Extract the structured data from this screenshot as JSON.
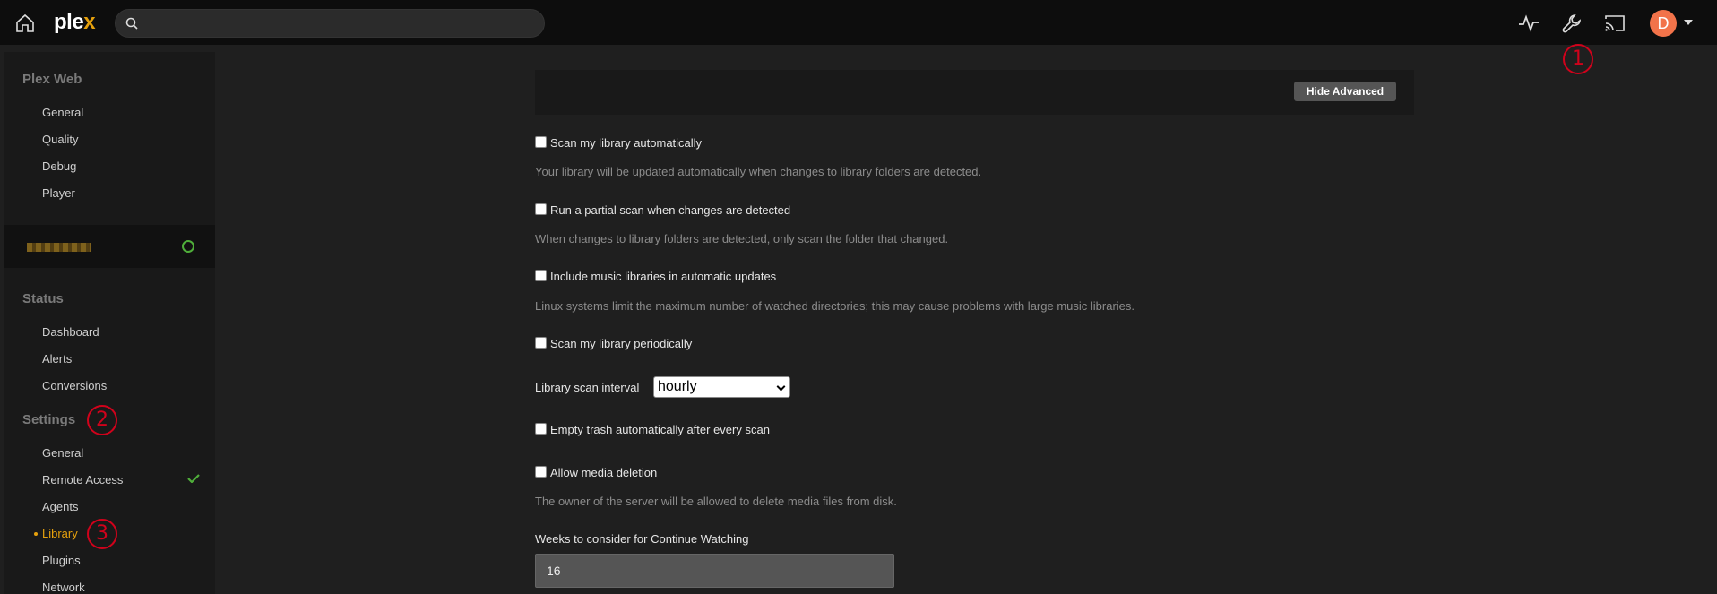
{
  "topbar": {
    "logo_main": "ple",
    "logo_x": "x",
    "search_placeholder": "",
    "avatar_initial": "D"
  },
  "annotations": [
    "1",
    "2",
    "3"
  ],
  "sidebar": {
    "plex_web_title": "Plex Web",
    "plex_web_items": [
      "General",
      "Quality",
      "Debug",
      "Player"
    ],
    "status_title": "Status",
    "status_items": [
      "Dashboard",
      "Alerts",
      "Conversions"
    ],
    "settings_title": "Settings",
    "settings_items": [
      "General",
      "Remote Access",
      "Agents",
      "Library",
      "Plugins",
      "Network"
    ],
    "active_item": "Library"
  },
  "main": {
    "hide_advanced_label": "Hide Advanced",
    "options": [
      {
        "label": "Scan my library automatically",
        "help": "Your library will be updated automatically when changes to library folders are detected.",
        "checked": false
      },
      {
        "label": "Run a partial scan when changes are detected",
        "help": "When changes to library folders are detected, only scan the folder that changed.",
        "checked": false
      },
      {
        "label": "Include music libraries in automatic updates",
        "help": "Linux systems limit the maximum number of watched directories; this may cause problems with large music libraries.",
        "checked": false
      },
      {
        "label": "Scan my library periodically",
        "help": "",
        "checked": false
      },
      {
        "label": "Empty trash automatically after every scan",
        "help": "",
        "checked": false
      },
      {
        "label": "Allow media deletion",
        "help": "The owner of the server will be allowed to delete media files from disk.",
        "checked": false
      }
    ],
    "scan_interval_label": "Library scan interval",
    "scan_interval_value": "hourly",
    "continue_watching_label": "Weeks to consider for Continue Watching",
    "continue_watching_value": "16"
  },
  "colors": {
    "accent": "#e5a00d",
    "annotation": "#d0021b",
    "avatar": "#f2734a",
    "ok": "#4fae3a"
  }
}
